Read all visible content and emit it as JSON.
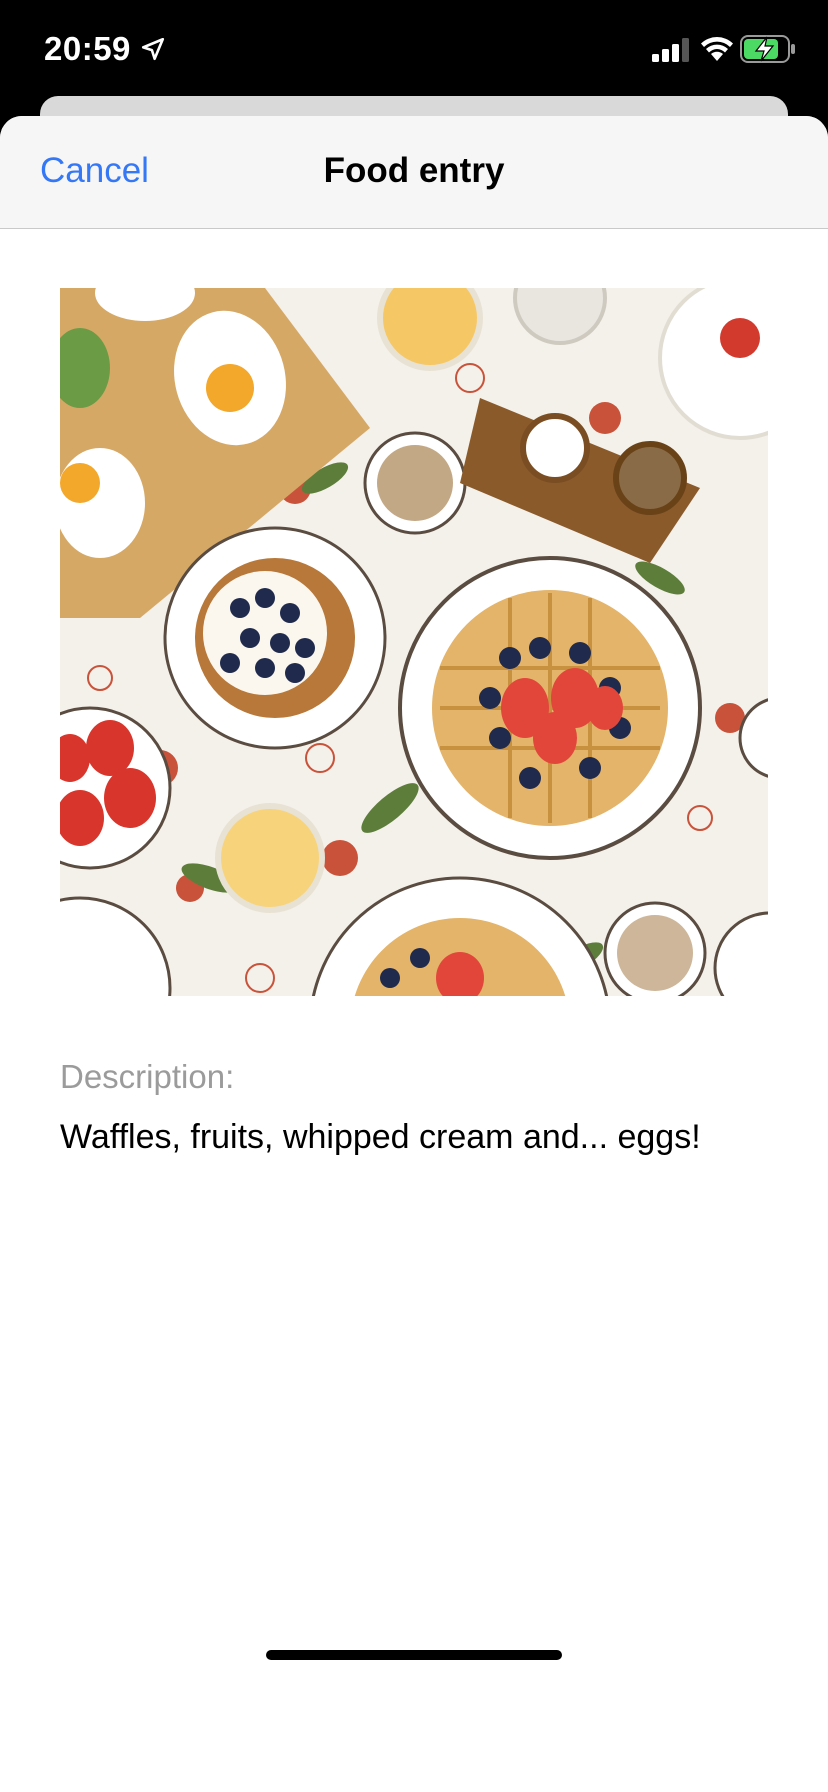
{
  "status_bar": {
    "time": "20:59"
  },
  "nav": {
    "cancel_label": "Cancel",
    "title": "Food entry"
  },
  "entry": {
    "description_label": "Description:",
    "description_text": "Waffles, fruits, whipped cream and... eggs!"
  },
  "colors": {
    "accent": "#3478f6",
    "battery": "#4cd964"
  },
  "icons": [
    "location-arrow-icon",
    "signal-icon",
    "wifi-icon",
    "battery-charging-icon"
  ]
}
